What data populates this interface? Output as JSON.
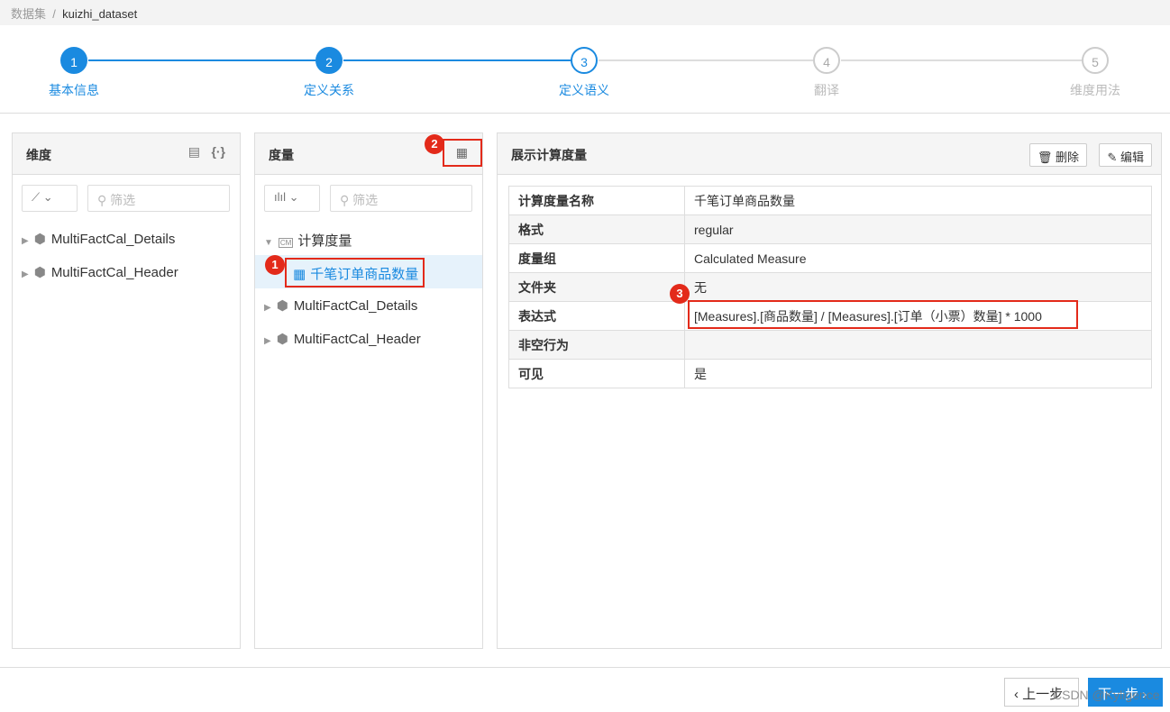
{
  "breadcrumb": {
    "root": "数据集",
    "sep": "/",
    "current": "kuizhi_dataset"
  },
  "steps": [
    {
      "n": "1",
      "label": "基本信息"
    },
    {
      "n": "2",
      "label": "定义关系"
    },
    {
      "n": "3",
      "label": "定义语义"
    },
    {
      "n": "4",
      "label": "翻译"
    },
    {
      "n": "5",
      "label": "维度用法"
    }
  ],
  "dim": {
    "title": "维度",
    "filter": "筛选",
    "items": [
      "MultiFactCal_Details",
      "MultiFactCal_Header"
    ]
  },
  "meas": {
    "title": "度量",
    "filter": "筛选",
    "group": "计算度量",
    "group_icon": "CM",
    "selected": "千笔订单商品数量",
    "items": [
      "MultiFactCal_Details",
      "MultiFactCal_Header"
    ]
  },
  "detail": {
    "title": "展示计算度量",
    "delete": "删除",
    "edit": "编辑",
    "rows": [
      [
        "计算度量名称",
        "千笔订单商品数量"
      ],
      [
        "格式",
        "regular"
      ],
      [
        "度量组",
        "Calculated Measure"
      ],
      [
        "文件夹",
        "无"
      ],
      [
        "表达式",
        "[Measures].[商品数量] / [Measures].[订单（小票）数量] * 1000"
      ],
      [
        "非空行为",
        ""
      ],
      [
        "可见",
        "是"
      ]
    ]
  },
  "badges": [
    "1",
    "2",
    "3"
  ],
  "footer": {
    "prev": "上一步",
    "next": "下一步",
    "watermark": "CSDN @Kyligence"
  }
}
